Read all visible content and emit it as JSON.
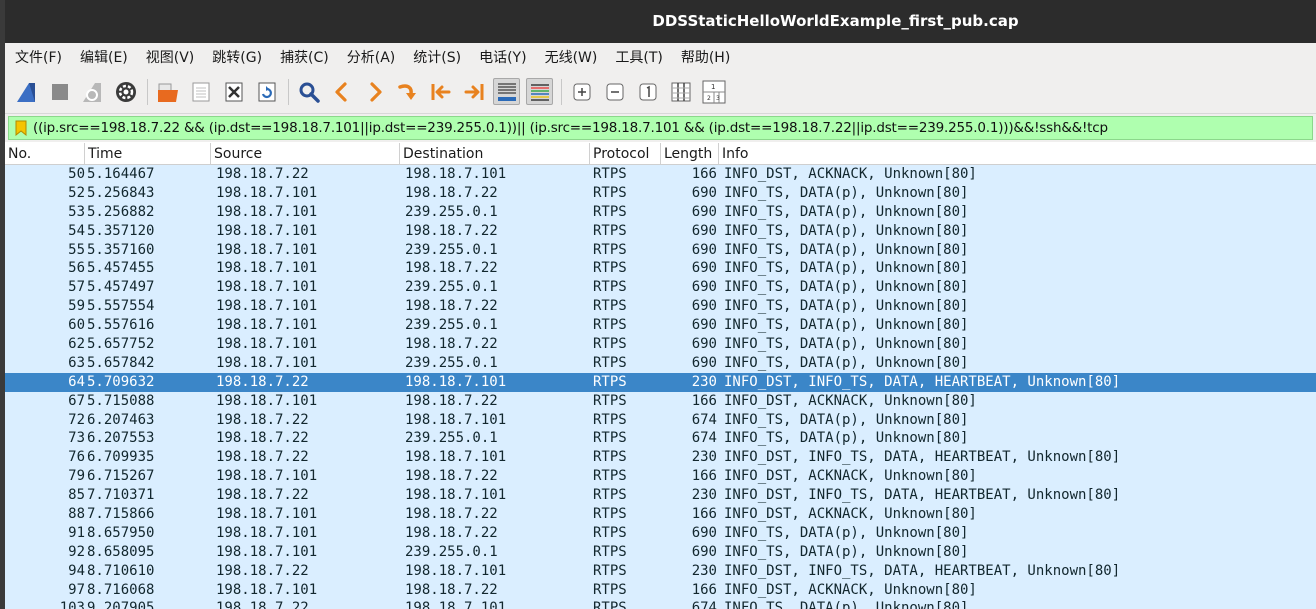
{
  "window": {
    "title": "DDSStaticHelloWorldExample_first_pub.cap"
  },
  "menu": [
    {
      "label": "文件(F)",
      "name": "menu-file"
    },
    {
      "label": "编辑(E)",
      "name": "menu-edit"
    },
    {
      "label": "视图(V)",
      "name": "menu-view"
    },
    {
      "label": "跳转(G)",
      "name": "menu-go"
    },
    {
      "label": "捕获(C)",
      "name": "menu-capture"
    },
    {
      "label": "分析(A)",
      "name": "menu-analyze"
    },
    {
      "label": "统计(S)",
      "name": "menu-statistics"
    },
    {
      "label": "电话(Y)",
      "name": "menu-telephony"
    },
    {
      "label": "无线(W)",
      "name": "menu-wireless"
    },
    {
      "label": "工具(T)",
      "name": "menu-tools"
    },
    {
      "label": "帮助(H)",
      "name": "menu-help"
    }
  ],
  "toolbar_icons": [
    "start-capture-icon",
    "stop-capture-icon",
    "restart-capture-icon",
    "capture-options-icon",
    "open-file-icon",
    "save-file-icon",
    "close-file-icon",
    "reload-file-icon",
    "find-packet-icon",
    "go-back-icon",
    "go-forward-icon",
    "go-to-packet-icon",
    "go-first-icon",
    "go-last-icon",
    "auto-scroll-icon",
    "colorize-icon",
    "zoom-in-icon",
    "zoom-out-icon",
    "normal-size-icon",
    "resize-columns-icon"
  ],
  "colors": {
    "filter_valid_bg": "#afffaf",
    "row_bg": "#daeeff",
    "row_selected_bg": "#3b86c8"
  },
  "filter": {
    "value": "((ip.src==198.18.7.22 && (ip.dst==198.18.7.101||ip.dst==239.255.0.1))|| (ip.src==198.18.7.101 && (ip.dst==198.18.7.22||ip.dst==239.255.0.1)))&&!ssh&&!tcp"
  },
  "columns": {
    "no": "No.",
    "time": "Time",
    "source": "Source",
    "destination": "Destination",
    "protocol": "Protocol",
    "length": "Length",
    "info": "Info"
  },
  "packets": [
    {
      "no": "50",
      "time": "5.164467",
      "src": "198.18.7.22",
      "dst": "198.18.7.101",
      "proto": "RTPS",
      "len": "166",
      "info": "INFO_DST, ACKNACK, Unknown[80]"
    },
    {
      "no": "52",
      "time": "5.256843",
      "src": "198.18.7.101",
      "dst": "198.18.7.22",
      "proto": "RTPS",
      "len": "690",
      "info": "INFO_TS, DATA(p), Unknown[80]"
    },
    {
      "no": "53",
      "time": "5.256882",
      "src": "198.18.7.101",
      "dst": "239.255.0.1",
      "proto": "RTPS",
      "len": "690",
      "info": "INFO_TS, DATA(p), Unknown[80]"
    },
    {
      "no": "54",
      "time": "5.357120",
      "src": "198.18.7.101",
      "dst": "198.18.7.22",
      "proto": "RTPS",
      "len": "690",
      "info": "INFO_TS, DATA(p), Unknown[80]"
    },
    {
      "no": "55",
      "time": "5.357160",
      "src": "198.18.7.101",
      "dst": "239.255.0.1",
      "proto": "RTPS",
      "len": "690",
      "info": "INFO_TS, DATA(p), Unknown[80]"
    },
    {
      "no": "56",
      "time": "5.457455",
      "src": "198.18.7.101",
      "dst": "198.18.7.22",
      "proto": "RTPS",
      "len": "690",
      "info": "INFO_TS, DATA(p), Unknown[80]"
    },
    {
      "no": "57",
      "time": "5.457497",
      "src": "198.18.7.101",
      "dst": "239.255.0.1",
      "proto": "RTPS",
      "len": "690",
      "info": "INFO_TS, DATA(p), Unknown[80]"
    },
    {
      "no": "59",
      "time": "5.557554",
      "src": "198.18.7.101",
      "dst": "198.18.7.22",
      "proto": "RTPS",
      "len": "690",
      "info": "INFO_TS, DATA(p), Unknown[80]"
    },
    {
      "no": "60",
      "time": "5.557616",
      "src": "198.18.7.101",
      "dst": "239.255.0.1",
      "proto": "RTPS",
      "len": "690",
      "info": "INFO_TS, DATA(p), Unknown[80]"
    },
    {
      "no": "62",
      "time": "5.657752",
      "src": "198.18.7.101",
      "dst": "198.18.7.22",
      "proto": "RTPS",
      "len": "690",
      "info": "INFO_TS, DATA(p), Unknown[80]"
    },
    {
      "no": "63",
      "time": "5.657842",
      "src": "198.18.7.101",
      "dst": "239.255.0.1",
      "proto": "RTPS",
      "len": "690",
      "info": "INFO_TS, DATA(p), Unknown[80]"
    },
    {
      "no": "64",
      "time": "5.709632",
      "src": "198.18.7.22",
      "dst": "198.18.7.101",
      "proto": "RTPS",
      "len": "230",
      "info": "INFO_DST, INFO_TS, DATA, HEARTBEAT, Unknown[80]",
      "selected": true
    },
    {
      "no": "67",
      "time": "5.715088",
      "src": "198.18.7.101",
      "dst": "198.18.7.22",
      "proto": "RTPS",
      "len": "166",
      "info": "INFO_DST, ACKNACK, Unknown[80]"
    },
    {
      "no": "72",
      "time": "6.207463",
      "src": "198.18.7.22",
      "dst": "198.18.7.101",
      "proto": "RTPS",
      "len": "674",
      "info": "INFO_TS, DATA(p), Unknown[80]"
    },
    {
      "no": "73",
      "time": "6.207553",
      "src": "198.18.7.22",
      "dst": "239.255.0.1",
      "proto": "RTPS",
      "len": "674",
      "info": "INFO_TS, DATA(p), Unknown[80]"
    },
    {
      "no": "76",
      "time": "6.709935",
      "src": "198.18.7.22",
      "dst": "198.18.7.101",
      "proto": "RTPS",
      "len": "230",
      "info": "INFO_DST, INFO_TS, DATA, HEARTBEAT, Unknown[80]"
    },
    {
      "no": "79",
      "time": "6.715267",
      "src": "198.18.7.101",
      "dst": "198.18.7.22",
      "proto": "RTPS",
      "len": "166",
      "info": "INFO_DST, ACKNACK, Unknown[80]"
    },
    {
      "no": "85",
      "time": "7.710371",
      "src": "198.18.7.22",
      "dst": "198.18.7.101",
      "proto": "RTPS",
      "len": "230",
      "info": "INFO_DST, INFO_TS, DATA, HEARTBEAT, Unknown[80]"
    },
    {
      "no": "88",
      "time": "7.715866",
      "src": "198.18.7.101",
      "dst": "198.18.7.22",
      "proto": "RTPS",
      "len": "166",
      "info": "INFO_DST, ACKNACK, Unknown[80]"
    },
    {
      "no": "91",
      "time": "8.657950",
      "src": "198.18.7.101",
      "dst": "198.18.7.22",
      "proto": "RTPS",
      "len": "690",
      "info": "INFO_TS, DATA(p), Unknown[80]"
    },
    {
      "no": "92",
      "time": "8.658095",
      "src": "198.18.7.101",
      "dst": "239.255.0.1",
      "proto": "RTPS",
      "len": "690",
      "info": "INFO_TS, DATA(p), Unknown[80]"
    },
    {
      "no": "94",
      "time": "8.710610",
      "src": "198.18.7.22",
      "dst": "198.18.7.101",
      "proto": "RTPS",
      "len": "230",
      "info": "INFO_DST, INFO_TS, DATA, HEARTBEAT, Unknown[80]"
    },
    {
      "no": "97",
      "time": "8.716068",
      "src": "198.18.7.101",
      "dst": "198.18.7.22",
      "proto": "RTPS",
      "len": "166",
      "info": "INFO_DST, ACKNACK, Unknown[80]"
    },
    {
      "no": "103",
      "time": "9.207905",
      "src": "198.18.7.22",
      "dst": "198.18.7.101",
      "proto": "RTPS",
      "len": "674",
      "info": "INFO_TS, DATA(p), Unknown[80]"
    }
  ]
}
